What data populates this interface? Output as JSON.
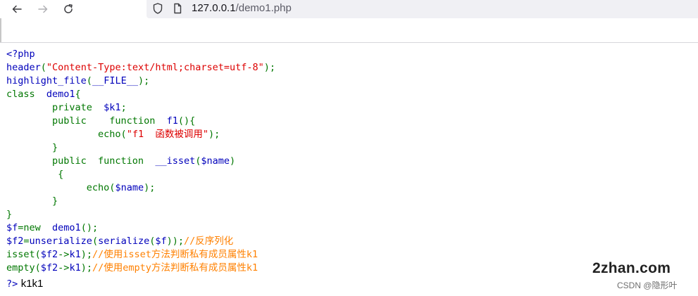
{
  "browser": {
    "back_icon": "arrow-left-icon",
    "forward_icon": "arrow-right-icon",
    "reload_icon": "reload-icon",
    "address": {
      "host": "127.0.0.1",
      "path": "/demo1.php"
    }
  },
  "source_lines": [
    [
      {
        "t": "df",
        "v": "<?php"
      }
    ],
    [
      {
        "t": "df",
        "v": "header"
      },
      {
        "t": "kw",
        "v": "("
      },
      {
        "t": "str",
        "v": "\"Content-Type:text/html;charset=utf-8\""
      },
      {
        "t": "kw",
        "v": ");"
      }
    ],
    [
      {
        "t": "df",
        "v": "highlight_file"
      },
      {
        "t": "kw",
        "v": "("
      },
      {
        "t": "df",
        "v": "__FILE__"
      },
      {
        "t": "kw",
        "v": ");"
      }
    ],
    [
      {
        "t": "kw",
        "v": "class  "
      },
      {
        "t": "df",
        "v": "demo1"
      },
      {
        "t": "kw",
        "v": "{"
      }
    ],
    [
      {
        "t": "kw",
        "v": "        private  "
      },
      {
        "t": "df",
        "v": "$k1"
      },
      {
        "t": "kw",
        "v": ";"
      }
    ],
    [
      {
        "t": "kw",
        "v": "        public    function  "
      },
      {
        "t": "df",
        "v": "f1"
      },
      {
        "t": "kw",
        "v": "(){"
      }
    ],
    [
      {
        "t": "kw",
        "v": "                echo("
      },
      {
        "t": "str",
        "v": "\"f1  函数被调用\""
      },
      {
        "t": "kw",
        "v": ");"
      }
    ],
    [
      {
        "t": "kw",
        "v": "        }"
      }
    ],
    [
      {
        "t": "kw",
        "v": "        public  function  "
      },
      {
        "t": "df",
        "v": "__isset"
      },
      {
        "t": "kw",
        "v": "("
      },
      {
        "t": "df",
        "v": "$name"
      },
      {
        "t": "kw",
        "v": ")"
      }
    ],
    [
      {
        "t": "kw",
        "v": "         {"
      }
    ],
    [
      {
        "t": "kw",
        "v": "              echo("
      },
      {
        "t": "df",
        "v": "$name"
      },
      {
        "t": "kw",
        "v": ");"
      }
    ],
    [
      {
        "t": "kw",
        "v": "        }"
      }
    ],
    [
      {
        "t": "kw",
        "v": "}"
      }
    ],
    [
      {
        "t": "df",
        "v": "$f"
      },
      {
        "t": "kw",
        "v": "=new  "
      },
      {
        "t": "df",
        "v": "demo1"
      },
      {
        "t": "kw",
        "v": "();"
      }
    ],
    [
      {
        "t": "df",
        "v": "$f2"
      },
      {
        "t": "kw",
        "v": "="
      },
      {
        "t": "df",
        "v": "unserialize"
      },
      {
        "t": "kw",
        "v": "("
      },
      {
        "t": "df",
        "v": "serialize"
      },
      {
        "t": "kw",
        "v": "("
      },
      {
        "t": "df",
        "v": "$f"
      },
      {
        "t": "kw",
        "v": "));"
      },
      {
        "t": "cm",
        "v": "//反序列化"
      }
    ],
    [
      {
        "t": "kw",
        "v": "isset("
      },
      {
        "t": "df",
        "v": "$f2"
      },
      {
        "t": "kw",
        "v": "->"
      },
      {
        "t": "df",
        "v": "k1"
      },
      {
        "t": "kw",
        "v": ");"
      },
      {
        "t": "cm",
        "v": "//使用isset方法判断私有成员属性k1"
      }
    ],
    [
      {
        "t": "kw",
        "v": "empty("
      },
      {
        "t": "df",
        "v": "$f2"
      },
      {
        "t": "kw",
        "v": "->"
      },
      {
        "t": "df",
        "v": "k1"
      },
      {
        "t": "kw",
        "v": ");"
      },
      {
        "t": "cm",
        "v": "//使用empty方法判断私有成员属性k1"
      }
    ]
  ],
  "output": {
    "close_tag": "?>",
    "text": "k1k1"
  },
  "watermark": {
    "site": "2zhan.com",
    "csdn": "CSDN @隐形叶"
  },
  "colors": {
    "default": "#0000bb",
    "keyword": "#007700",
    "string": "#dd0000",
    "comment": "#ff8000"
  }
}
